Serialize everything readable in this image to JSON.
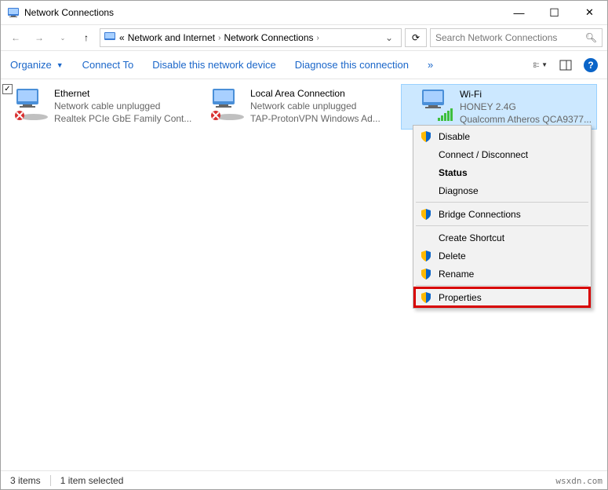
{
  "window": {
    "title": "Network Connections"
  },
  "breadcrumb": {
    "back_label": "«",
    "path1": "Network and Internet",
    "path2": "Network Connections"
  },
  "search": {
    "placeholder": "Search Network Connections"
  },
  "toolbar": {
    "organize": "Organize",
    "connect_to": "Connect To",
    "disable": "Disable this network device",
    "diagnose": "Diagnose this connection",
    "more": "»"
  },
  "connections": [
    {
      "name": "Ethernet",
      "status": "Network cable unplugged",
      "adapter": "Realtek PCIe GbE Family Cont...",
      "selected": false,
      "disabled": true
    },
    {
      "name": "Local Area Connection",
      "status": "Network cable unplugged",
      "adapter": "TAP-ProtonVPN Windows Ad...",
      "selected": false,
      "disabled": true
    },
    {
      "name": "Wi-Fi",
      "status": "HONEY 2.4G",
      "adapter": "Qualcomm Atheros QCA9377...",
      "selected": true,
      "disabled": false
    }
  ],
  "ctxmenu": {
    "disable": "Disable",
    "connect": "Connect / Disconnect",
    "status": "Status",
    "diagnose": "Diagnose",
    "bridge": "Bridge Connections",
    "shortcut": "Create Shortcut",
    "delete": "Delete",
    "rename": "Rename",
    "properties": "Properties"
  },
  "statusbar": {
    "count": "3 items",
    "selected": "1 item selected"
  },
  "watermark": "wsxdn.com"
}
